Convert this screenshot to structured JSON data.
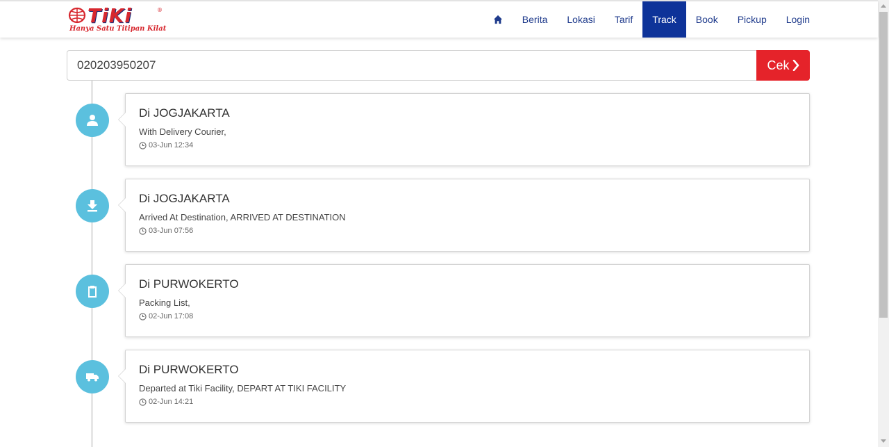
{
  "header": {
    "logo_text": "TiKi",
    "logo_reg": "®",
    "tagline": "Hanya Satu Titipan Kilat",
    "nav": [
      {
        "id": "home",
        "icon": "home-icon"
      },
      {
        "id": "berita",
        "label": "Berita"
      },
      {
        "id": "lokasi",
        "label": "Lokasi"
      },
      {
        "id": "tarif",
        "label": "Tarif"
      },
      {
        "id": "track",
        "label": "Track",
        "active": true
      },
      {
        "id": "book",
        "label": "Book"
      },
      {
        "id": "pickup",
        "label": "Pickup"
      },
      {
        "id": "login",
        "label": "Login"
      }
    ]
  },
  "search": {
    "value": "020203950207",
    "button_label": "Cek"
  },
  "timeline": [
    {
      "icon": "user-icon",
      "location": "Di JOGJAKARTA",
      "description": "With Delivery Courier,",
      "time": "03-Jun 12:34"
    },
    {
      "icon": "download-icon",
      "location": "Di JOGJAKARTA",
      "description": "Arrived At Destination, ARRIVED AT DESTINATION",
      "time": "03-Jun 07:56"
    },
    {
      "icon": "clipboard-icon",
      "location": "Di PURWOKERTO",
      "description": "Packing List,",
      "time": "02-Jun 17:08"
    },
    {
      "icon": "truck-icon",
      "location": "Di PURWOKERTO",
      "description": "Departed at Tiki Facility, DEPART AT TIKI FACILITY",
      "time": "02-Jun 14:21"
    }
  ],
  "colors": {
    "brand_red": "#e5232a",
    "nav_active": "#0e3399",
    "timeline_icon": "#5bc0de"
  }
}
